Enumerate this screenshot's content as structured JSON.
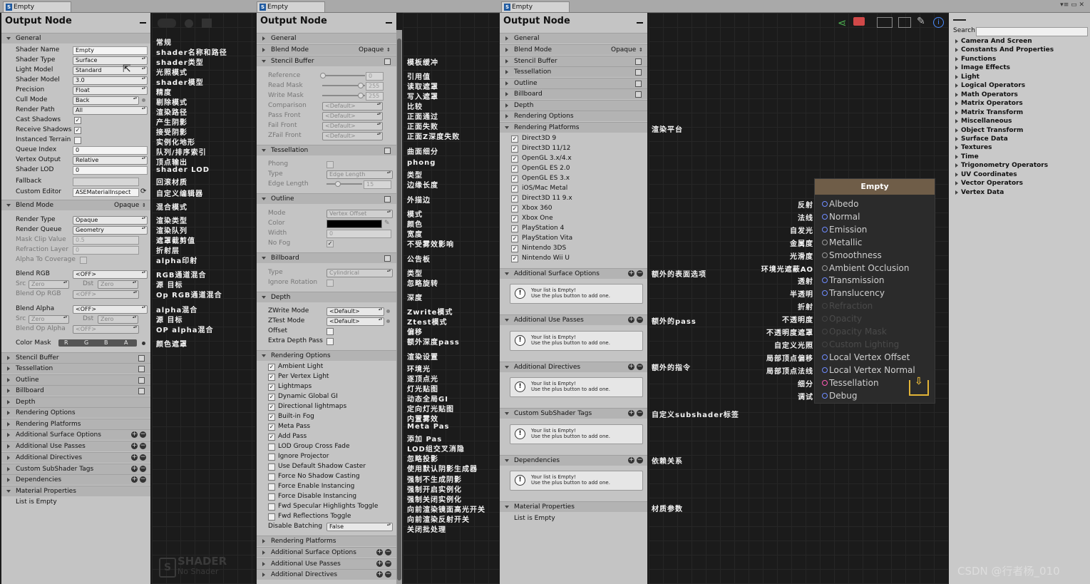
{
  "tabs": {
    "tab1": "Empty",
    "tab2": "Empty",
    "tab3": "Empty"
  },
  "panel1": {
    "title": "Output Node",
    "general": "General",
    "shader_name_label": "Shader Name",
    "shader_name_value": "Empty",
    "shader_type_label": "Shader Type",
    "shader_type_value": "Surface",
    "light_model_label": "Light Model",
    "light_model_value": "Standard",
    "shader_model_label": "Shader Model",
    "shader_model_value": "3.0",
    "precision_label": "Precision",
    "precision_value": "Float",
    "cull_mode_label": "Cull Mode",
    "cull_mode_value": "Back",
    "render_path_label": "Render Path",
    "render_path_value": "All",
    "cast_shadows_label": "Cast Shadows",
    "receive_shadows_label": "Receive Shadows",
    "instanced_terrain_label": "Instanced Terrain",
    "queue_index_label": "Queue Index",
    "queue_index_value": "0",
    "vertex_output_label": "Vertex Output",
    "vertex_output_value": "Relative",
    "shader_lod_label": "Shader LOD",
    "shader_lod_value": "0",
    "fallback_label": "Fallback",
    "custom_editor_label": "Custom Editor",
    "custom_editor_value": "ASEMaterialInspect",
    "blend_mode": "Blend Mode",
    "blend_mode_value": "Opaque",
    "render_type_label": "Render Type",
    "render_type_value": "Opaque",
    "render_queue_label": "Render Queue",
    "render_queue_value": "Geometry",
    "mask_clip_label": "Mask Clip Value",
    "mask_clip_value": "0.5",
    "refraction_layer_label": "Refraction Layer",
    "refraction_layer_value": "0",
    "alpha_to_coverage_label": "Alpha To Coverage",
    "blend_rgb_label": "Blend RGB",
    "blend_rgb_value": "<OFF>",
    "src_label": "Src",
    "src_value": "Zero",
    "dst_label": "Dst",
    "dst_value": "Zero",
    "blend_op_rgb_label": "Blend Op RGB",
    "blend_op_rgb_value": "<OFF>",
    "blend_alpha_label": "Blend Alpha",
    "blend_alpha_value": "<OFF>",
    "src2_value": "Zero",
    "dst2_value": "Zero",
    "blend_op_alpha_label": "Blend Op Alpha",
    "blend_op_alpha_value": "<OFF>",
    "color_mask_label": "Color Mask",
    "cm_r": "R",
    "cm_g": "G",
    "cm_b": "B",
    "cm_a": "A",
    "stencil_buffer": "Stencil Buffer",
    "tessellation": "Tessellation",
    "outline": "Outline",
    "billboard": "Billboard",
    "depth": "Depth",
    "rendering_options": "Rendering Options",
    "rendering_platforms": "Rendering Platforms",
    "additional_surface_options": "Additional Surface Options",
    "additional_use_passes": "Additional Use Passes",
    "additional_directives": "Additional Directives",
    "custom_subshader_tags": "Custom SubShader Tags",
    "dependencies": "Dependencies",
    "material_properties": "Material Properties",
    "list_is_empty": "List is Empty"
  },
  "canvas1": {
    "watermark": "SHADER",
    "watermark_sub": "No Shader",
    "notes": [
      "常规",
      "shader名称和路径",
      "shader类型",
      "光照模式",
      "shader模型",
      "精度",
      "剔除模式",
      "渲染路径",
      "产生阴影",
      "接受阴影",
      "实例化地形",
      "队列/排序索引",
      "顶点输出",
      "shader LOD",
      "回滚材质",
      "自定义编辑器",
      "混合模式",
      "渲染类型",
      "渲染队列",
      "遮罩截剪值",
      "折射层",
      "alpha印射",
      "RGB通道混合",
      "源    目标",
      "Op RGB通道混合",
      "alpha混合",
      "源    目标",
      "OP alpha混合",
      "颜色遮罩"
    ]
  },
  "panel2": {
    "title": "Output Node",
    "general": "General",
    "blend_mode": "Blend Mode",
    "blend_mode_value": "Opaque",
    "stencil_buffer": "Stencil Buffer",
    "reference": "Reference",
    "reference_value": "0",
    "read_mask": "Read Mask",
    "read_mask_value": "255",
    "write_mask": "Write Mask",
    "write_mask_value": "255",
    "comparison": "Comparison",
    "default": "<Default>",
    "pass_front": "Pass Front",
    "fail_front": "Fail Front",
    "zfail_front": "ZFail Front",
    "tessellation": "Tessellation",
    "phong": "Phong",
    "type": "Type",
    "type_value": "Edge Length",
    "edge_length": "Edge Length",
    "edge_length_value": "15",
    "outline": "Outline",
    "mode": "Mode",
    "mode_value": "Vertex Offset",
    "color": "Color",
    "width": "Width",
    "width_value": "0",
    "no_fog": "No Fog",
    "billboard": "Billboard",
    "bb_type": "Type",
    "bb_type_value": "Cylindrical",
    "ignore_rotation": "Ignore Rotation",
    "depth": "Depth",
    "zwrite_mode": "ZWrite Mode",
    "ztest_mode": "ZTest Mode",
    "offset": "Offset",
    "extra_depth_pass": "Extra Depth Pass",
    "rendering_options": "Rendering Options",
    "ro_items": [
      "Ambient Light",
      "Per Vertex Light",
      "Lightmaps",
      "Dynamic Global GI",
      "Directional lightmaps",
      "Built-in Fog",
      "Meta Pass",
      "Add Pass",
      "LOD Group Cross Fade",
      "Ignore Projector",
      "Use Default Shadow Caster",
      "Force No Shadow Casting",
      "Force Enable Instancing",
      "Force Disable Instancing",
      "Fwd Specular Highlights Toggle",
      "Fwd Reflections Toggle"
    ],
    "disable_batching": "Disable Batching",
    "disable_batching_value": "False",
    "rendering_platforms": "Rendering Platforms",
    "additional_surface_options": "Additional Surface Options",
    "additional_use_passes": "Additional Use Passes",
    "additional_directives": "Additional Directives"
  },
  "canvas2": {
    "notes": [
      "模板缓冲",
      "引用值",
      "读取遮罩",
      "写入遮罩",
      "比较",
      "正面通过",
      "正面失败",
      "正面Z深度失败",
      "曲面细分",
      "phong",
      "类型",
      "边缘长度",
      "外描边",
      "模式",
      "颜色",
      "宽度",
      "不受雾效影响",
      "公告板",
      "类型",
      "忽略旋转",
      "深度",
      "Zwrite模式",
      "Ztest模式",
      "偏移",
      "额外深度pass",
      "渲染设置",
      "环境光",
      "逐顶点光",
      "灯光贴图",
      "动态全局GI",
      "定向灯光贴图",
      "内置雾效",
      "Meta Pas",
      "添加 Pas",
      "LOD组交叉消隐",
      "忽略投影",
      "使用默认阴影生成器",
      "强制不生成阴影",
      "强制开启实例化",
      "强制关闭实例化",
      "向前渲染镜面高光开关",
      "向前渲染反射开关",
      "关闭批处理"
    ]
  },
  "panel3": {
    "title": "Output Node",
    "general": "General",
    "blend_mode": "Blend Mode",
    "blend_mode_value": "Opaque",
    "stencil_buffer": "Stencil Buffer",
    "tessellation": "Tessellation",
    "outline": "Outline",
    "billboard": "Billboard",
    "depth": "Depth",
    "rendering_options": "Rendering Options",
    "rendering_platforms": "Rendering Platforms",
    "platforms": [
      "Direct3D 9",
      "Direct3D 11/12",
      "OpenGL 3.x/4.x",
      "OpenGL ES 2.0",
      "OpenGL ES 3.x",
      "iOS/Mac Metal",
      "Direct3D 11 9.x",
      "Xbox 360",
      "Xbox One",
      "PlayStation 4",
      "PlayStation Vita",
      "Nintendo 3DS",
      "Nintendo Wii U"
    ],
    "additional_surface_options": "Additional Surface Options",
    "additional_use_passes": "Additional Use Passes",
    "additional_directives": "Additional Directives",
    "custom_subshader_tags": "Custom SubShader Tags",
    "dependencies": "Dependencies",
    "material_properties": "Material Properties",
    "list_is_empty": "List is Empty",
    "empty_line1": "Your list is Empty!",
    "empty_line2": "Use the plus button to add one."
  },
  "canvas3": {
    "notes": [
      "渲染平台",
      "额外的表面选项",
      "额外的pass",
      "额外的指令",
      "自定义subshader标签",
      "依赖关系",
      "材质参数"
    ],
    "port_notes": [
      "反射",
      "法线",
      "自发光",
      "金属度",
      "光滑度",
      "环境光遮蔽AO",
      "透射",
      "半透明",
      "折射",
      "不透明度",
      "不透明度遮罩",
      "自定义光照",
      "局部顶点偏移",
      "局部顶点法线",
      "细分",
      "调试"
    ]
  },
  "node": {
    "title": "Empty",
    "ports": [
      "Albedo",
      "Normal",
      "Emission",
      "Metallic",
      "Smoothness",
      "Ambient Occlusion",
      "Transmission",
      "Translucency",
      "Refraction",
      "Opacity",
      "Opacity Mask",
      "Custom Lighting",
      "Local Vertex Offset",
      "Local Vertex Normal",
      "Tessellation",
      "Debug"
    ]
  },
  "palette": {
    "search_label": "Search",
    "items": [
      "Camera And Screen",
      "Constants And Properties",
      "Functions",
      "Image Effects",
      "Light",
      "Logical Operators",
      "Math Operators",
      "Matrix Operators",
      "Matrix Transform",
      "Miscellaneous",
      "Object Transform",
      "Surface Data",
      "Textures",
      "Time",
      "Trigonometry Operators",
      "UV Coordinates",
      "Vector Operators",
      "Vertex Data"
    ]
  },
  "watermark_credit": "CSDN @行者杨_010",
  "colors": {
    "node_header": "#6f5d48",
    "port_active": "#6f8cff",
    "port_tessellation": "#ff5ab4",
    "accent_icon": "#e2b437"
  }
}
